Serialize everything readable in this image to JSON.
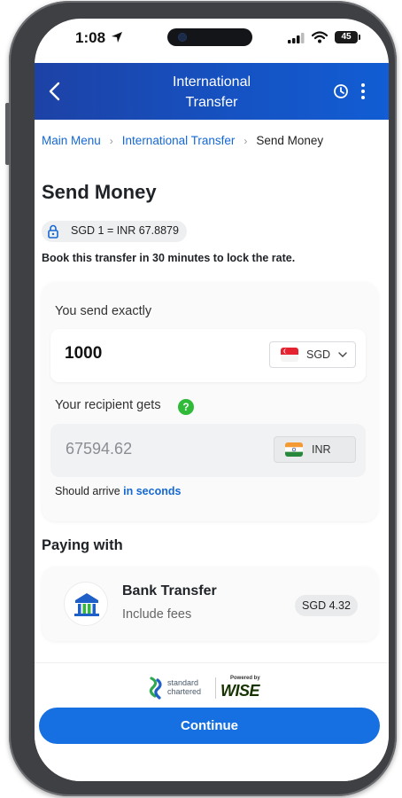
{
  "status_bar": {
    "time": "1:08",
    "battery": "45"
  },
  "header": {
    "title_line1": "International",
    "title_line2": "Transfer"
  },
  "breadcrumb": {
    "items": [
      "Main Menu",
      "International Transfer",
      "Send Money"
    ]
  },
  "page_title": "Send Money",
  "rate": {
    "text": "SGD 1 = INR 67.8879"
  },
  "lock_notice": "Book this transfer in 30 minutes to lock the rate.",
  "send": {
    "label": "You send exactly",
    "amount": "1000",
    "currency": "SGD"
  },
  "receive": {
    "label": "Your recipient gets",
    "help_icon": "?",
    "amount": "67594.62",
    "currency": "INR"
  },
  "arrival": {
    "prefix": "Should arrive",
    "highlight": "in seconds"
  },
  "paying_with": {
    "title": "Paying with",
    "method": "Bank Transfer",
    "subtitle": "Include fees",
    "fee": "SGD 4.32"
  },
  "branding": {
    "bank_line1": "standard",
    "bank_line2": "chartered",
    "powered_by": "Powered by",
    "partner": "WISE"
  },
  "continue_label": "Continue",
  "colors": {
    "header": "#1553c4",
    "link": "#1568d3",
    "primary_button": "#1770e1",
    "help": "#2fba38"
  }
}
